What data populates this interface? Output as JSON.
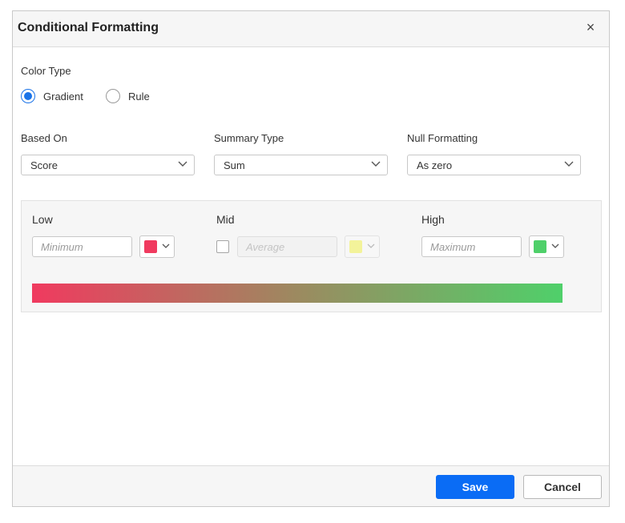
{
  "dialog": {
    "title": "Conditional Formatting",
    "close_glyph": "×"
  },
  "color_type": {
    "label": "Color Type",
    "options": [
      {
        "label": "Gradient",
        "checked": true
      },
      {
        "label": "Rule",
        "checked": false
      }
    ]
  },
  "dropdowns": {
    "based_on": {
      "label": "Based On",
      "value": "Score"
    },
    "summary_type": {
      "label": "Summary Type",
      "value": "Sum"
    },
    "null_formatting": {
      "label": "Null Formatting",
      "value": "As zero"
    }
  },
  "gradient": {
    "low": {
      "label": "Low",
      "placeholder": "Minimum",
      "color": "#f03a5f"
    },
    "mid": {
      "label": "Mid",
      "placeholder": "Average",
      "color": "#f3f39a",
      "enabled": false
    },
    "high": {
      "label": "High",
      "placeholder": "Maximum",
      "color": "#4fd06a"
    }
  },
  "footer": {
    "save_label": "Save",
    "cancel_label": "Cancel"
  },
  "colors": {
    "accent": "#0a6cf5"
  }
}
